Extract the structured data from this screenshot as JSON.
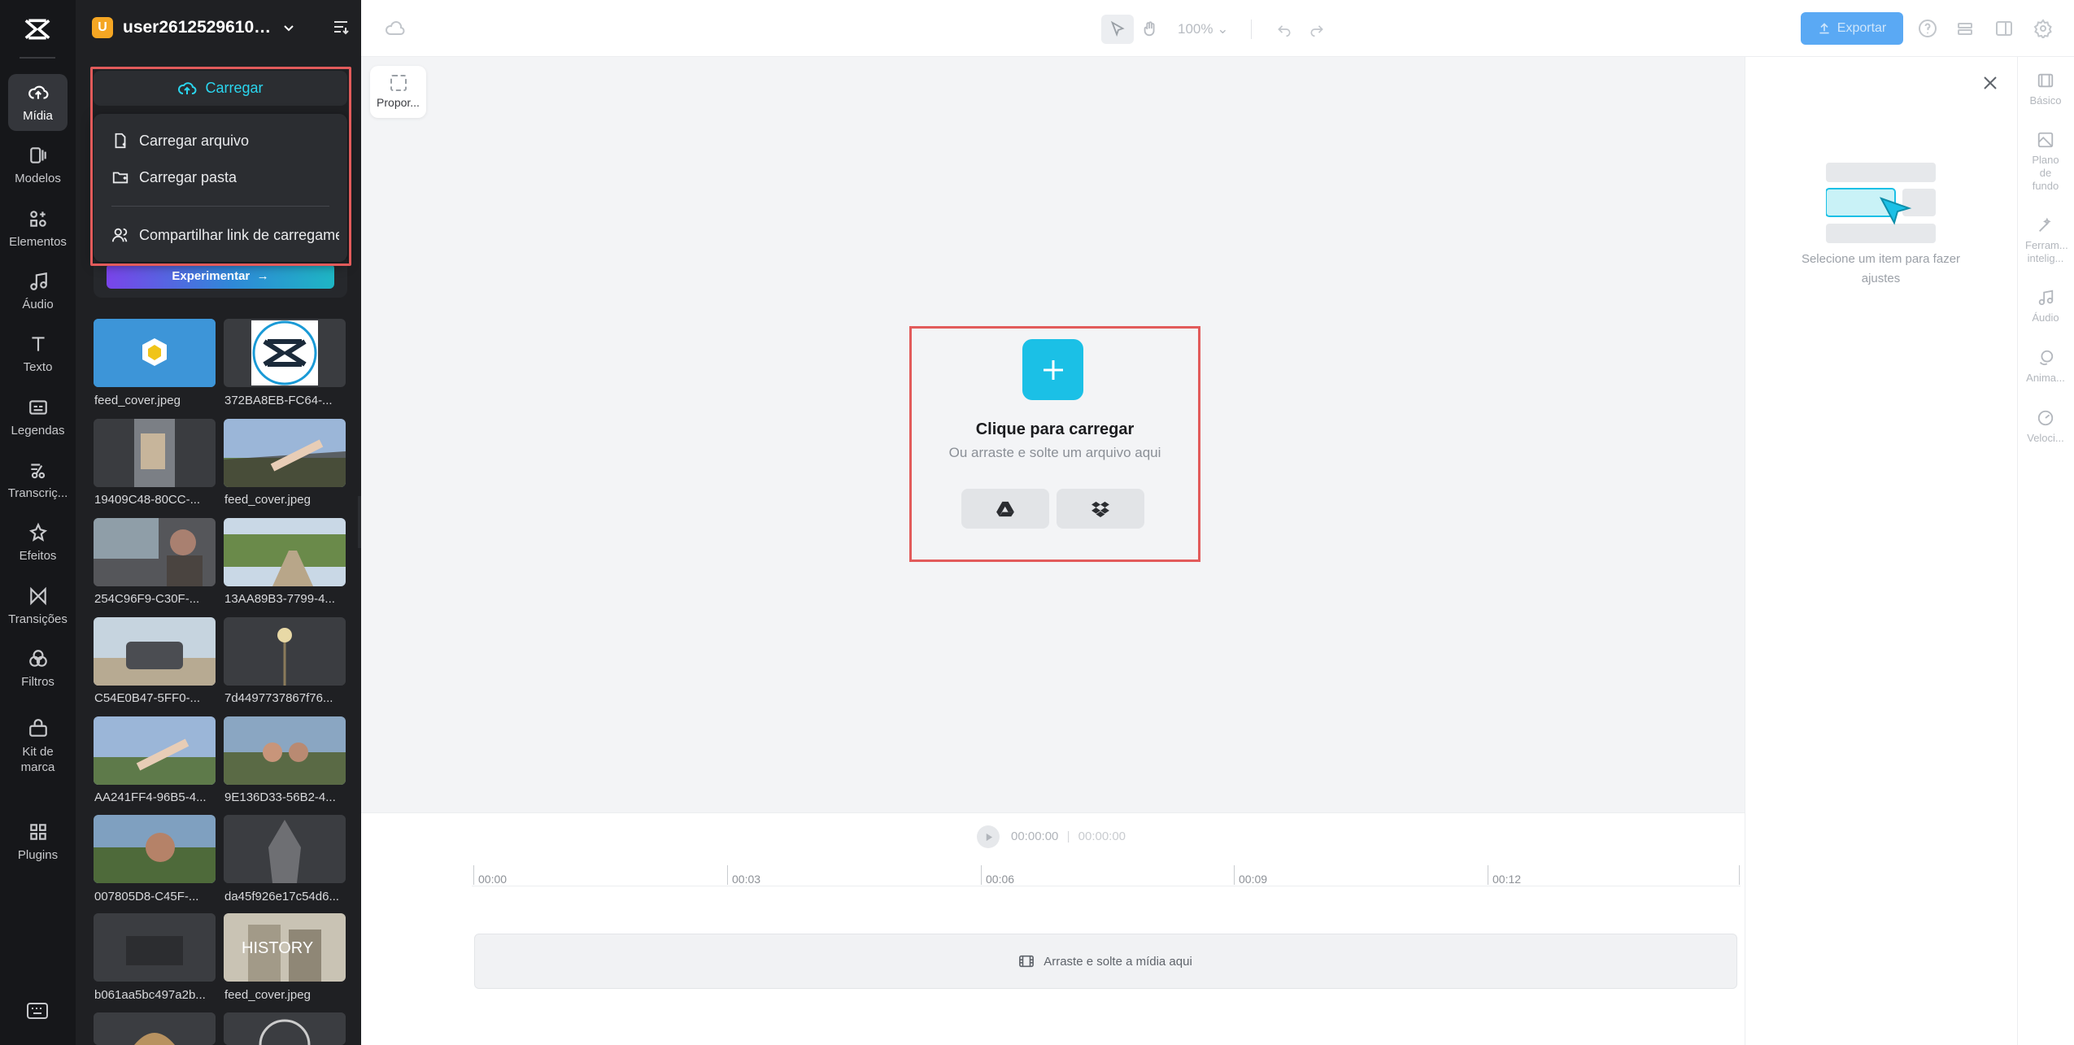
{
  "rail": {
    "items": [
      {
        "label": "Mídia",
        "icon": "cloud-upload-icon"
      },
      {
        "label": "Modelos",
        "icon": "templates-icon"
      },
      {
        "label": "Elementos",
        "icon": "elements-icon"
      },
      {
        "label": "Áudio",
        "icon": "music-note-icon"
      },
      {
        "label": "Texto",
        "icon": "text-icon"
      },
      {
        "label": "Legendas",
        "icon": "captions-icon"
      },
      {
        "label": "Transcriç...",
        "icon": "transcript-icon"
      },
      {
        "label": "Efeitos",
        "icon": "effects-icon"
      },
      {
        "label": "Transições",
        "icon": "transitions-icon"
      },
      {
        "label": "Filtros",
        "icon": "filters-icon"
      },
      {
        "label": "Kit de marca",
        "icon": "brand-kit-icon"
      },
      {
        "label": "Plugins",
        "icon": "plugins-icon"
      }
    ]
  },
  "panel": {
    "avatar_letter": "U",
    "username": "user261252961006'...",
    "upload_label": "Carregar",
    "dropdown": {
      "upload_file": "Carregar arquivo",
      "upload_folder": "Carregar pasta",
      "share_link": "Compartilhar link de carregamento"
    },
    "try_label": "Experimentar",
    "media": [
      {
        "name": "feed_cover.jpeg"
      },
      {
        "name": "372BA8EB-FC64-..."
      },
      {
        "name": "19409C48-80CC-..."
      },
      {
        "name": "feed_cover.jpeg"
      },
      {
        "name": "254C96F9-C30F-..."
      },
      {
        "name": "13AA89B3-7799-4..."
      },
      {
        "name": "C54E0B47-5FF0-..."
      },
      {
        "name": "7d4497737867f76..."
      },
      {
        "name": "AA241FF4-96B5-4..."
      },
      {
        "name": "9E136D33-56B2-4..."
      },
      {
        "name": "007805D8-C45F-..."
      },
      {
        "name": "da45f926e17c54d6..."
      },
      {
        "name": "b061aa5bc497a2b..."
      },
      {
        "name": "feed_cover.jpeg"
      }
    ],
    "history_text": "HISTORY"
  },
  "topbar": {
    "zoom": "100%",
    "export_label": "Exportar"
  },
  "canvas": {
    "ratio_label": "Propor...",
    "upload_title": "Clique para carregar",
    "upload_subtitle": "Ou arraste e solte um arquivo aqui"
  },
  "right_panel": {
    "hint": "Selecione um item para fazer ajustes",
    "tabs": [
      {
        "label": "Básico"
      },
      {
        "label": "Plano de fundo"
      },
      {
        "label": "Ferram... intelig..."
      },
      {
        "label": "Áudio"
      },
      {
        "label": "Anima..."
      },
      {
        "label": "Veloci..."
      }
    ]
  },
  "timeline": {
    "current_time": "00:00:00",
    "total_time": "00:00:00",
    "ticks": [
      "00:00",
      "00:03",
      "00:06",
      "00:09",
      "00:12"
    ],
    "drop_hint": "Arraste e solte a mídia aqui"
  },
  "colors": {
    "accent": "#1bc0e6",
    "highlight_box": "#e25b5b"
  }
}
